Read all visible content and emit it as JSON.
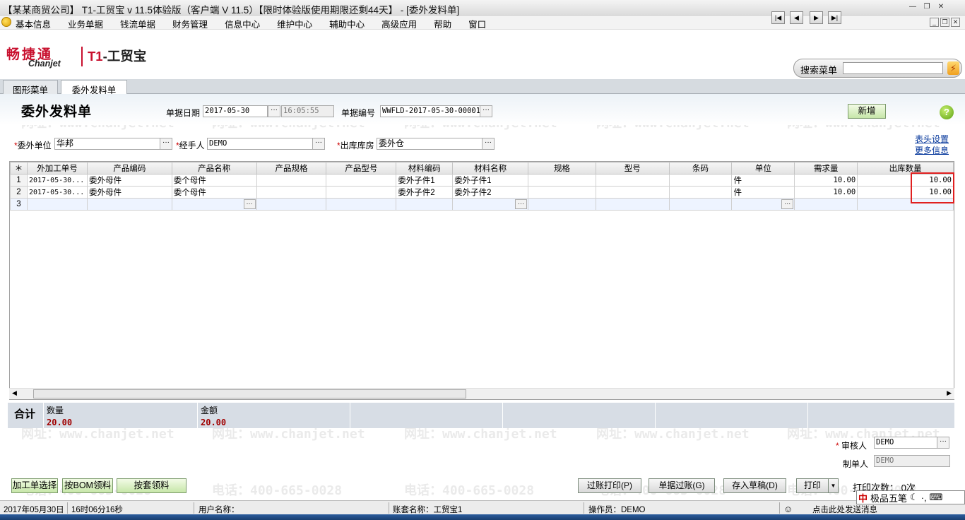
{
  "window": {
    "title": "【某某商贸公司】 T1-工贸宝 v 11.5体验版（客户端 V 11.5）【限时体验版使用期限还剩44天】 - [委外发料单]"
  },
  "menu": [
    "基本信息",
    "业务单据",
    "钱流单据",
    "财务管理",
    "信息中心",
    "维护中心",
    "辅助中心",
    "高级应用",
    "帮助",
    "窗口"
  ],
  "brand": {
    "cn": "畅捷通",
    "en": "Chanjet",
    "product_prefix": "T1",
    "product": "-工贸宝"
  },
  "search": {
    "label": "搜索菜单",
    "value": ""
  },
  "tabs": [
    "图形菜单",
    "委外发料单"
  ],
  "form": {
    "title": "委外发料单",
    "date_label": "单据日期",
    "date": "2017-05-30",
    "time": "16:05:55",
    "docno_label": "单据编号",
    "docno": "WWFLD-2017-05-30-00001",
    "new_button": "新增",
    "vendor_label": "委外单位",
    "vendor": "华邦",
    "handler_label": "经手人",
    "handler": "DEMO",
    "warehouse_label": "出库库房",
    "warehouse": "委外仓",
    "link_header_settings": "表头设置",
    "link_more_info": "更多信息"
  },
  "grid": {
    "columns": [
      "＊",
      "外加工单号",
      "产品编码",
      "产品名称",
      "产品规格",
      "产品型号",
      "材料编码",
      "材料名称",
      "规格",
      "型号",
      "条码",
      "单位",
      "需求量",
      "出库数量"
    ],
    "rows": [
      [
        "1",
        "2017-05-30...",
        "委外母件",
        "委个母件",
        "",
        "",
        "委外子件1",
        "委外子件1",
        "",
        "",
        "",
        "件",
        "10.00",
        "10.00"
      ],
      [
        "2",
        "2017-05-30...",
        "委外母件",
        "委个母件",
        "",
        "",
        "委外子件2",
        "委外子件2",
        "",
        "",
        "",
        "件",
        "10.00",
        "10.00"
      ],
      [
        "3",
        "",
        "",
        "",
        "",
        "",
        "",
        "",
        "",
        "",
        "",
        "",
        "",
        ""
      ]
    ]
  },
  "totals": {
    "label": "合计",
    "qty_label": "数量",
    "qty": "20.00",
    "amount_label": "金额",
    "amount": "20.00"
  },
  "approval": {
    "auditor_label": "审核人",
    "auditor": "DEMO",
    "maker_label": "制单人",
    "maker": "DEMO"
  },
  "buttons": {
    "select_order": "加工单选择",
    "bom": "按BOM领料",
    "set": "按套领料",
    "post_print": "过账打印(P)",
    "post": "单据过账(G)",
    "draft": "存入草稿(D)",
    "print": "打印",
    "print_count": "打印次数：  0次"
  },
  "status": {
    "date": "2017年05月30日",
    "time": "16时06分16秒",
    "user": "用户名称：",
    "account": "账套名称：工贸宝1",
    "operator": "操作员：DEMO",
    "msg": "点击此处发送消息"
  },
  "ime": {
    "name": "极品五笔"
  },
  "watermark": {
    "phone": "电话：400-665-0028",
    "web": "网址：www.chanjet.net"
  }
}
